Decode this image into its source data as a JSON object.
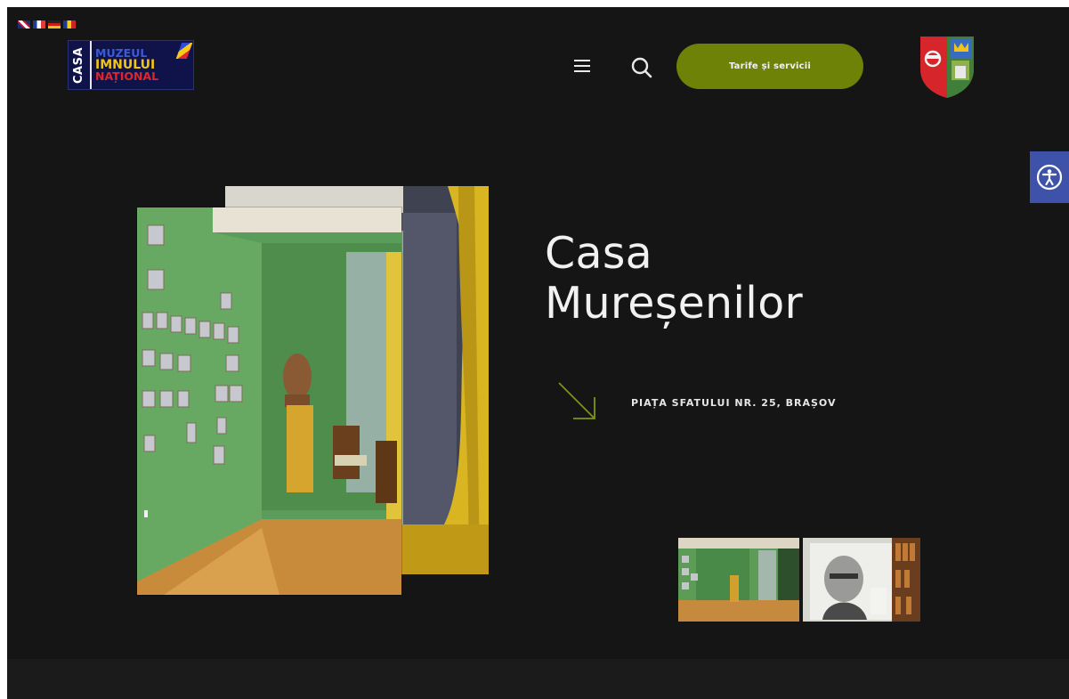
{
  "languages": [
    "EN",
    "FR",
    "DE",
    "RO"
  ],
  "logo": {
    "casa": "CASA",
    "line1": "MUZEUL",
    "line2": "IMNULUI",
    "line3": "NAȚIONAL"
  },
  "header": {
    "menu_icon": "hamburger-menu-icon",
    "search_icon": "search-icon",
    "cta_label": "Tarife și servicii",
    "crest_icon": "coat-of-arms-icon"
  },
  "accessibility_icon": "accessibility-icon",
  "hero": {
    "title_line1": "Casa",
    "title_line2": "Mureșenilor",
    "address": "PIAȚA SFATULUI NR. 25, BRAȘOV",
    "arrow_icon": "arrow-down-right-icon"
  },
  "colors": {
    "background": "#151515",
    "accent": "#6f8208",
    "accessibility": "#3d52a8"
  }
}
